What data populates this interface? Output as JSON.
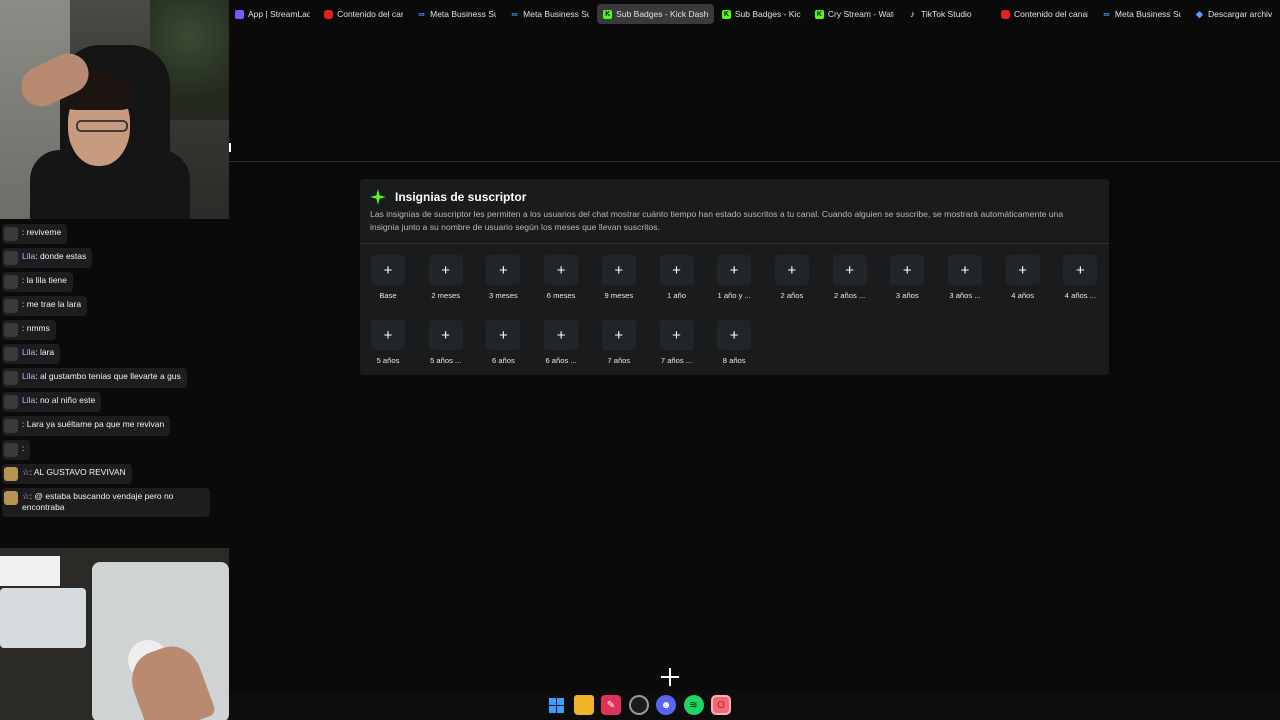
{
  "tabs": [
    {
      "label": "App | StreamLadder",
      "icon": "app-icon",
      "active": false
    },
    {
      "label": "Contenido del canal",
      "icon": "youtube-icon",
      "active": false
    },
    {
      "label": "Meta Business Suite",
      "icon": "meta-icon",
      "active": false
    },
    {
      "label": "Meta Business Suite",
      "icon": "meta-icon",
      "active": false
    },
    {
      "label": "Sub Badges - Kick Dashbo",
      "icon": "kick-icon",
      "active": true
    },
    {
      "label": "Sub Badges - Kick D",
      "icon": "kick-icon",
      "active": false
    },
    {
      "label": "Cry Stream - Watch",
      "icon": "kick-icon",
      "active": false
    },
    {
      "label": "TikTok Studio",
      "icon": "tiktok-icon",
      "active": false
    },
    {
      "label": "Contenido del canal",
      "icon": "youtube-icon",
      "active": false
    },
    {
      "label": "Meta Business Suite",
      "icon": "meta-icon",
      "active": false
    },
    {
      "label": "Descargar archivo",
      "icon": "download-icon",
      "active": false
    }
  ],
  "panel": {
    "title": "Insignias de suscriptor",
    "description": "Las insignias de suscriptor les permiten a los usuarios del chat mostrar cuánto tiempo han estado suscritos a tu canal. Cuando alguien se suscribe, se mostrará automáticamente una insignia junto a su nombre de usuario según los meses que llevan suscritos.",
    "add_symbol": "+",
    "badges": [
      "Base",
      "2 meses",
      "3 meses",
      "6 meses",
      "9 meses",
      "1 año",
      "1 año y ...",
      "2 años",
      "2 años ...",
      "3 años",
      "3 años ...",
      "4 años",
      "4 años ...",
      "5 años",
      "5 años ...",
      "6 años",
      "6 años ...",
      "7 años",
      "7 años ...",
      "8 años"
    ]
  },
  "chat": [
    {
      "user": "",
      "text": ": reviveme",
      "avatar": "dark"
    },
    {
      "user": "Lila",
      "text": ": donde estas",
      "avatar": "dark"
    },
    {
      "user": "",
      "text": ": la lila tiene",
      "avatar": "dark"
    },
    {
      "user": "",
      "text": ": me trae la lara",
      "avatar": "dark"
    },
    {
      "user": "",
      "text": ": nmms",
      "avatar": "dark"
    },
    {
      "user": "Lila",
      "text": ": lara",
      "avatar": "dark"
    },
    {
      "user": "Lila",
      "text": ": al gustambo tenias que llevarte a gus",
      "avatar": "dark"
    },
    {
      "user": "Lila",
      "text": ": no al niño este",
      "avatar": "dark"
    },
    {
      "user": "",
      "text": ": Lara ya suéltame pa que me revivan",
      "avatar": "dark"
    },
    {
      "user": "",
      "text": ":",
      "avatar": "dark"
    },
    {
      "user": "☆",
      "text": ": AL GUSTAVO REVIVAN",
      "avatar": "gold"
    },
    {
      "user": "☆",
      "text": ": @ estaba buscando vendaje pero no encontraba",
      "avatar": "gold"
    }
  ],
  "taskbar": [
    "windows-start-icon",
    "file-explorer-icon",
    "app-red-icon",
    "chrome-icon",
    "discord-icon",
    "spotify-icon",
    "opera-gx-icon"
  ],
  "colors": {
    "accent": "#53fc18",
    "panel_bg": "#191b1c",
    "badge_bg": "#222527",
    "chat_user": "#c6b4ff"
  }
}
